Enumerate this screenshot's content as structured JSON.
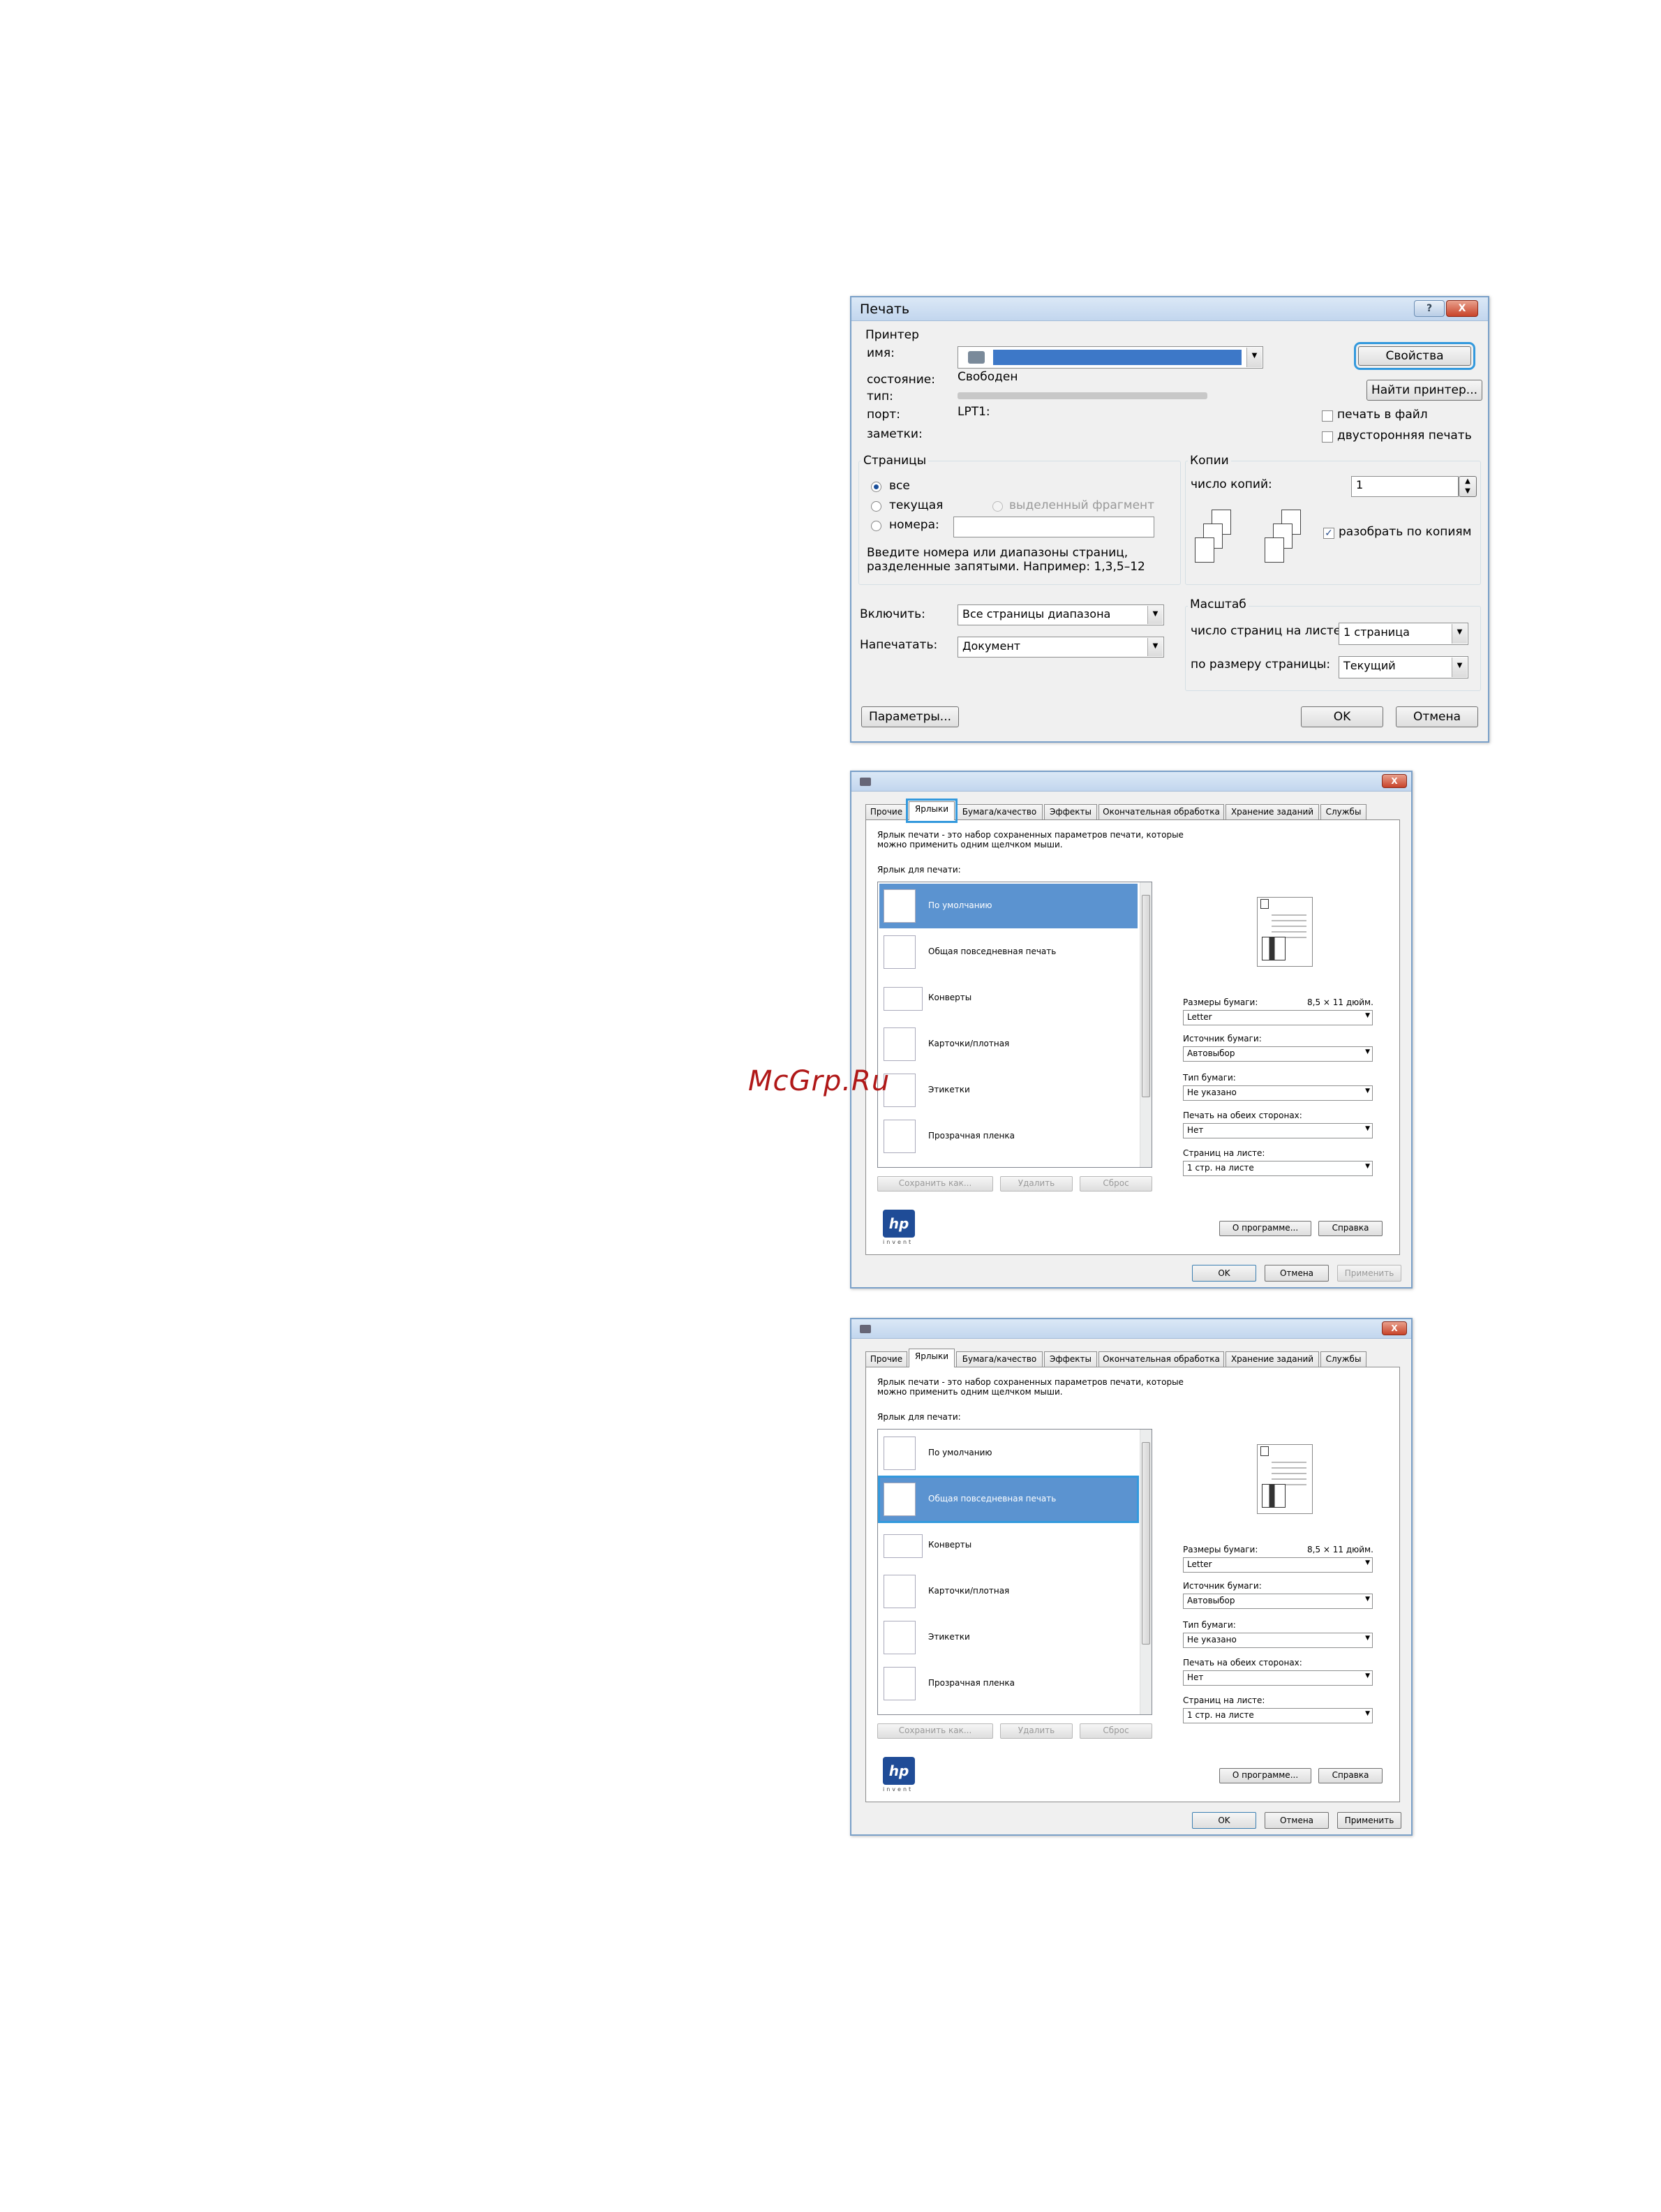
{
  "watermark": "McGrp.Ru",
  "print_dialog": {
    "title": "Печать",
    "help_btn": "?",
    "close_btn": "X",
    "printer_group": "Принтер",
    "name_label": "имя:",
    "state_label": "состояние:",
    "state_value": "Свободен",
    "type_label": "тип:",
    "port_label": "порт:",
    "port_value": "LPT1:",
    "notes_label": "заметки:",
    "properties_btn": "Свойства",
    "find_printer_btn": "Найти принтер...",
    "print_to_file": "печать в файл",
    "duplex": "двусторонняя печать",
    "pages_group": "Страницы",
    "all": "все",
    "current": "текущая",
    "selection": "выделенный фрагмент",
    "numbers": "номера:",
    "hint": "Введите номера или диапазоны страниц,\nразделенные запятыми. Например: 1,3,5–12",
    "copies_group": "Копии",
    "copies_label": "число копий:",
    "copies_value": "1",
    "collate": "разобрать по копиям",
    "include_label": "Включить:",
    "include_value": "Все страницы диапазона",
    "print_what_label": "Напечатать:",
    "print_what_value": "Документ",
    "scale_group": "Масштаб",
    "pages_per_sheet_label": "число страниц на листе:",
    "pages_per_sheet_value": "1 страница",
    "fit_label": "по размеру страницы:",
    "fit_value": "Текущий",
    "options_btn": "Параметры...",
    "ok_btn": "OK",
    "cancel_btn": "Отмена"
  },
  "props": {
    "tabs": [
      "Прочие",
      "Ярлыки",
      "Бумага/качество",
      "Эффекты",
      "Окончательная обработка",
      "Хранение заданий",
      "Службы"
    ],
    "intro": "Ярлык печати - это набор сохраненных параметров печати, которые\nможно применить одним щелчком мыши.",
    "shortcut_label": "Ярлык для печати:",
    "items": [
      "По умолчанию",
      "Общая повседневная печать",
      "Конверты",
      "Карточки/плотная",
      "Этикетки",
      "Прозрачная пленка"
    ],
    "save_as": "Сохранить как...",
    "delete": "Удалить",
    "reset": "Сброс",
    "paper_size_label": "Размеры бумаги:",
    "paper_size_dims": "8,5 × 11 дюйм.",
    "paper_size_value": "Letter",
    "source_label": "Источник бумаги:",
    "source_value": "Автовыбор",
    "type_label": "Тип бумаги:",
    "type_value": "Не указано",
    "duplex_label": "Печать на обеих сторонах:",
    "duplex_value": "Нет",
    "pps_label": "Страниц на листе:",
    "pps_value": "1 стр. на листе",
    "about": "О программе...",
    "help": "Справка",
    "ok": "OK",
    "cancel": "Отмена",
    "apply": "Применить",
    "logo": "hp",
    "logo_sub": "invent"
  },
  "colors": {
    "highlight": "#3399dd",
    "selection": "#5b93d0"
  }
}
